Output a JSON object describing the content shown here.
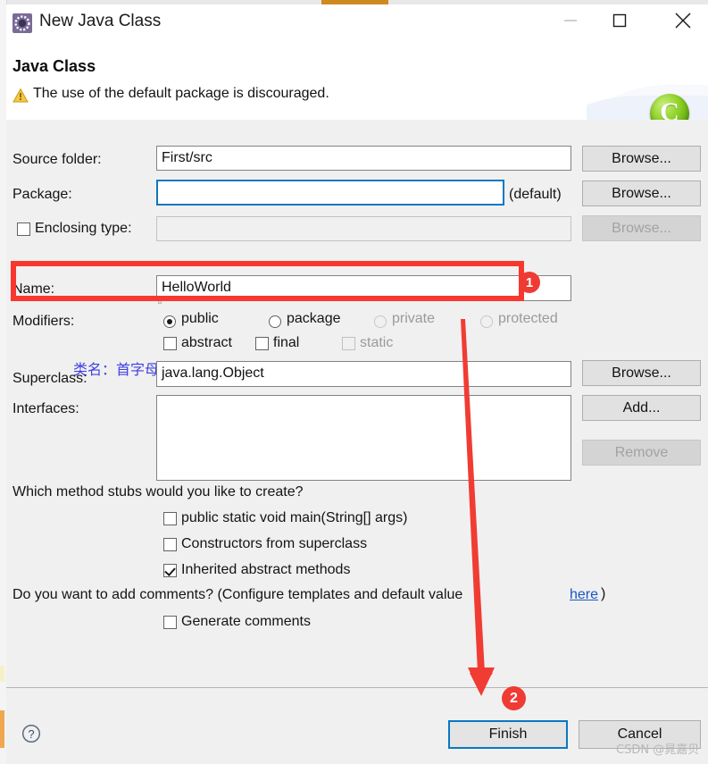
{
  "window": {
    "title": "New Java Class",
    "icon": "java-class-icon",
    "controls": {
      "minimize": "minimize-icon",
      "maximize": "maximize-icon",
      "close": "close-icon"
    }
  },
  "header": {
    "heading": "Java Class",
    "warning_icon": "warning-triangle-icon",
    "warning_message": "The use of the default package is discouraged.",
    "brand_glyph": "C"
  },
  "form": {
    "source_folder": {
      "label": "Source folder:",
      "value": "First/src",
      "browse": "Browse..."
    },
    "package": {
      "label": "Package:",
      "value": "",
      "default_hint": "(default)",
      "browse": "Browse...",
      "assist_icon": "content-assist-lightbulb-icon"
    },
    "enclosing_type": {
      "label": "Enclosing type:",
      "checked": false,
      "value": "",
      "browse": "Browse...",
      "browse_disabled": true
    },
    "annotation_note": "类名：首字母大写，不能以数字开头，不允许出现中文",
    "name": {
      "label": "Name:",
      "value": "HelloWorld"
    },
    "modifiers": {
      "label": "Modifiers:",
      "radios": [
        {
          "label": "public",
          "selected": true,
          "disabled": false
        },
        {
          "label": "package",
          "selected": false,
          "disabled": false
        },
        {
          "label": "private",
          "selected": false,
          "disabled": true
        },
        {
          "label": "protected",
          "selected": false,
          "disabled": true
        }
      ],
      "checkboxes": [
        {
          "label": "abstract",
          "checked": false,
          "disabled": false
        },
        {
          "label": "final",
          "checked": false,
          "disabled": false
        },
        {
          "label": "static",
          "checked": false,
          "disabled": true
        }
      ]
    },
    "superclass": {
      "label": "Superclass:",
      "value": "java.lang.Object",
      "browse": "Browse..."
    },
    "interfaces": {
      "label": "Interfaces:",
      "value": "",
      "add": "Add...",
      "remove": "Remove",
      "remove_disabled": true
    },
    "stubs": {
      "question": "Which method stubs would you like to create?",
      "options": [
        {
          "label": "public static void main(String[] args)",
          "checked": false
        },
        {
          "label": "Constructors from superclass",
          "checked": false
        },
        {
          "label": "Inherited abstract methods",
          "checked": true
        }
      ]
    },
    "comments": {
      "question_prefix": "Do you want to add comments? (Configure templates and default value ",
      "link": "here",
      "question_suffix": ")",
      "option": {
        "label": "Generate comments",
        "checked": false
      }
    }
  },
  "footer": {
    "help_icon": "help-question-icon",
    "finish": "Finish",
    "cancel": "Cancel"
  },
  "annotations": {
    "step_one": "1",
    "step_two": "2",
    "watermark": "CSDN @晁嘉贝"
  },
  "colors": {
    "annotation_red": "#ef3b33",
    "focus_blue": "#0b77c2",
    "note_blue": "#3f3fe0",
    "link_blue": "#1a56c4",
    "brand_green": "#8fd227",
    "accent_orange": "#cf8a1f"
  }
}
